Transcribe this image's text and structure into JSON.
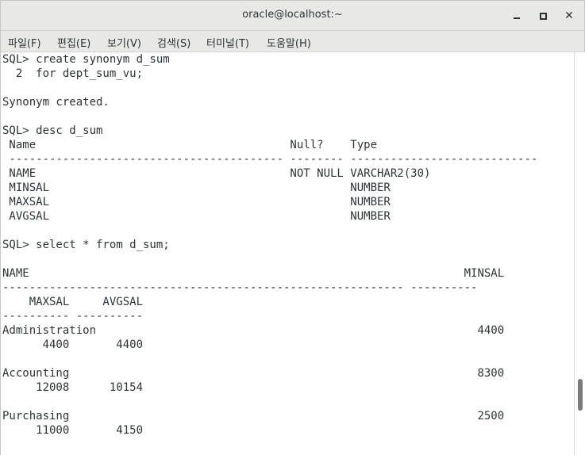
{
  "window": {
    "title": "oracle@localhost:~",
    "minimize_icon": "minimize-icon",
    "maximize_icon": "maximize-icon",
    "close_icon": "close-icon",
    "close_glyph": "✕"
  },
  "menu": {
    "items": [
      {
        "label": "파일(F)"
      },
      {
        "label": "편집(E)"
      },
      {
        "label": "보기(V)"
      },
      {
        "label": "검색(S)"
      },
      {
        "label": "터미널(T)"
      },
      {
        "label": "도움말(H)"
      }
    ]
  },
  "terminal": {
    "lines": [
      "SQL> create synonym d_sum",
      "  2  for dept_sum_vu;",
      "",
      "Synonym created.",
      "",
      "SQL> desc d_sum",
      " Name                                      Null?    Type",
      " ----------------------------------------- -------- ----------------------------",
      " NAME                                      NOT NULL VARCHAR2(30)",
      " MINSAL                                             NUMBER",
      " MAXSAL                                             NUMBER",
      " AVGSAL                                             NUMBER",
      "",
      "SQL> select * from d_sum;",
      "",
      "NAME                                                                 MINSAL",
      "------------------------------------------------------------ ----------",
      "    MAXSAL     AVGSAL",
      "---------- ----------",
      "Administration                                                         4400",
      "      4400       4400",
      "",
      "Accounting                                                             8300",
      "     12008      10154",
      "",
      "Purchasing                                                             2500",
      "     11000       4150"
    ]
  },
  "scrollbar": {
    "position": 0.88
  }
}
